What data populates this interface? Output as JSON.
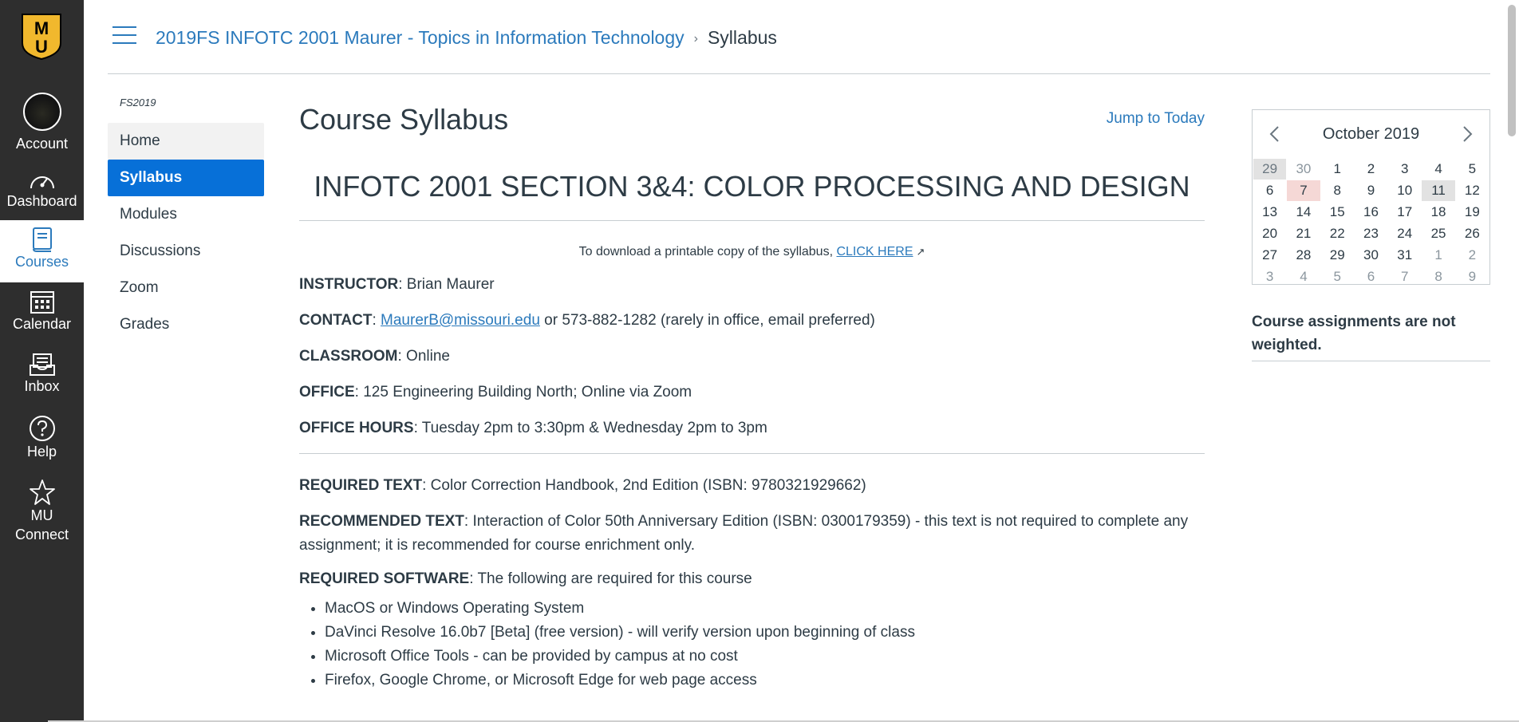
{
  "global_nav": {
    "logo_text": "MU",
    "items": [
      {
        "label": "Account",
        "icon": "avatar"
      },
      {
        "label": "Dashboard",
        "icon": "dashboard-icon"
      },
      {
        "label": "Courses",
        "icon": "courses-icon"
      },
      {
        "label": "Calendar",
        "icon": "calendar-icon"
      },
      {
        "label": "Inbox",
        "icon": "inbox-icon"
      },
      {
        "label": "Help",
        "icon": "help-icon"
      },
      {
        "label": "MU Connect",
        "icon": "star-icon"
      }
    ]
  },
  "header": {
    "breadcrumb": {
      "course": "2019FS INFOTC 2001 Maurer - Topics in Information Technology",
      "separator": "›",
      "current": "Syllabus"
    }
  },
  "course_nav": {
    "term": "FS2019",
    "items": [
      "Home",
      "Syllabus",
      "Modules",
      "Discussions",
      "Zoom",
      "Grades"
    ],
    "active": "Syllabus"
  },
  "main": {
    "title": "Course Syllabus",
    "jump_to_today": "Jump to Today",
    "heading": "INFOTC 2001 SECTION 3&4: COLOR PROCESSING AND DESIGN",
    "download": {
      "text": "To download a printable copy of the syllabus, ",
      "link": "CLICK HERE",
      "ext_icon": "↗"
    },
    "instructor": {
      "label": "INSTRUCTOR",
      "value": ": Brian Maurer"
    },
    "contact": {
      "label": "CONTACT",
      "sep": ": ",
      "email": "MaurerB@missouri.edu",
      "rest": " or 573-882-1282 (rarely in office, email preferred)"
    },
    "classroom": {
      "label": "CLASSROOM",
      "value": ": Online"
    },
    "office": {
      "label": "OFFICE",
      "value": ": 125 Engineering Building North; Online via Zoom"
    },
    "office_hours": {
      "label": "OFFICE HOURS",
      "value": ": Tuesday 2pm to 3:30pm & Wednesday 2pm to 3pm"
    },
    "required_text": {
      "label": "REQUIRED TEXT",
      "value": ": Color Correction Handbook, 2nd Edition (ISBN: 9780321929662)"
    },
    "recommended_text": {
      "label": "RECOMMENDED TEXT",
      "value": ": Interaction of Color 50th Anniversary Edition (ISBN: 0300179359) - this text is not required to complete any assignment; it is recommended for course enrichment only."
    },
    "required_software": {
      "label": "REQUIRED SOFTWARE",
      "value": ": The following are required for this course"
    },
    "software_list": [
      "MacOS or Windows Operating System",
      "DaVinci Resolve 16.0b7 [Beta] (free version) - will verify version upon beginning of class",
      "Microsoft Office Tools - can be provided by campus at no cost",
      "Firefox, Google Chrome, or Microsoft Edge for web page access"
    ]
  },
  "calendar": {
    "month": "October 2019",
    "weeks": [
      [
        "29",
        "30",
        "1",
        "2",
        "3",
        "4",
        "5"
      ],
      [
        "6",
        "7",
        "8",
        "9",
        "10",
        "11",
        "12"
      ],
      [
        "13",
        "14",
        "15",
        "16",
        "17",
        "18",
        "19"
      ],
      [
        "20",
        "21",
        "22",
        "23",
        "24",
        "25",
        "26"
      ],
      [
        "27",
        "28",
        "29",
        "30",
        "31",
        "1",
        "2"
      ],
      [
        "3",
        "4",
        "5",
        "6",
        "7",
        "8",
        "9"
      ]
    ],
    "today": "7",
    "selected": "11"
  },
  "sidebar": {
    "weights_note": "Course assignments are not weighted."
  }
}
